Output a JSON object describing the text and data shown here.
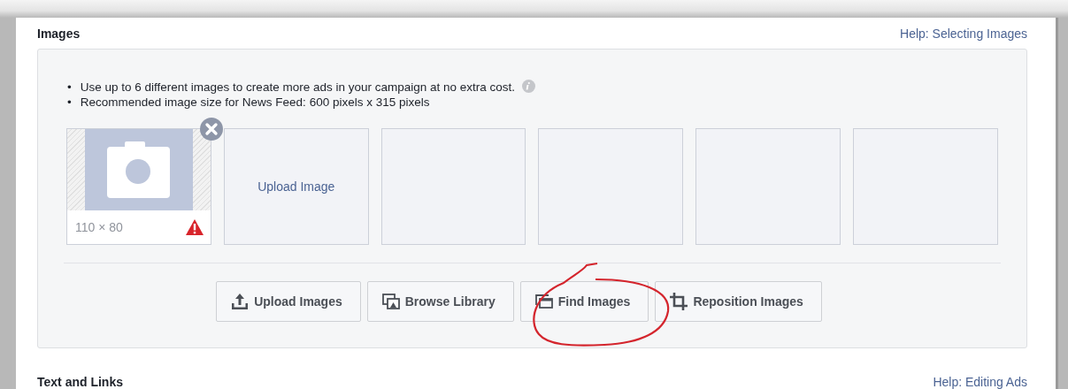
{
  "sections": [
    {
      "title": "Images",
      "help_link": "Help: Selecting Images"
    },
    {
      "title": "Text and Links",
      "help_link": "Help: Editing Ads"
    }
  ],
  "notes": [
    {
      "marker": "•",
      "text": "Use up to 6 different images to create more ads in your campaign at no extra cost."
    },
    {
      "marker": "•",
      "text": "Recommended image size for News Feed: 600 pixels x 315 pixels"
    }
  ],
  "tiles": [
    {
      "kind": "image",
      "size": "110 × 80",
      "warning": true,
      "removable": true
    },
    {
      "kind": "upload",
      "label": "Upload Image"
    },
    {
      "kind": "empty"
    },
    {
      "kind": "empty"
    },
    {
      "kind": "empty"
    },
    {
      "kind": "empty"
    }
  ],
  "buttons": [
    {
      "kind": "upload",
      "label": "Upload Images"
    },
    {
      "kind": "library",
      "label": "Browse Library"
    },
    {
      "kind": "find",
      "label": "Find Images"
    },
    {
      "kind": "crop",
      "label": "Reposition Images"
    }
  ]
}
